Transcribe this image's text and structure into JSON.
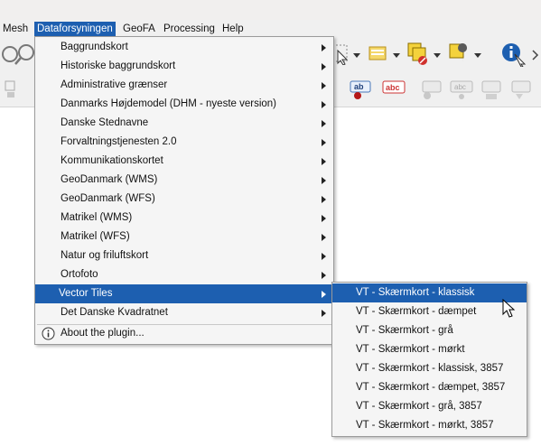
{
  "menubar": {
    "items": [
      {
        "label": "Mesh"
      },
      {
        "label": "Dataforsyningen"
      },
      {
        "label": "GeoFA"
      },
      {
        "label": "Processing"
      },
      {
        "label": "Help"
      }
    ]
  },
  "main_menu": {
    "items": [
      {
        "label": "Baggrundskort"
      },
      {
        "label": "Historiske baggrundskort"
      },
      {
        "label": "Administrative grænser"
      },
      {
        "label": "Danmarks Højdemodel (DHM - nyeste version)"
      },
      {
        "label": "Danske Stednavne"
      },
      {
        "label": "Forvaltningstjenesten 2.0"
      },
      {
        "label": "Kommunikationskortet"
      },
      {
        "label": "GeoDanmark (WMS)"
      },
      {
        "label": "GeoDanmark (WFS)"
      },
      {
        "label": "Matrikel (WMS)"
      },
      {
        "label": "Matrikel (WFS)"
      },
      {
        "label": "Natur og friluftskort"
      },
      {
        "label": "Ortofoto"
      },
      {
        "label": "Vector Tiles"
      },
      {
        "label": "Det Danske Kvadratnet"
      }
    ],
    "about": "About the plugin..."
  },
  "submenu": {
    "items": [
      {
        "label": "VT - Skærmkort - klassisk"
      },
      {
        "label": "VT - Skærmkort - dæmpet"
      },
      {
        "label": "VT - Skærmkort - grå"
      },
      {
        "label": "VT - Skærmkort - mørkt"
      },
      {
        "label": "VT - Skærmkort - klassisk, 3857"
      },
      {
        "label": "VT - Skærmkort - dæmpet, 3857"
      },
      {
        "label": "VT - Skærmkort - grå, 3857"
      },
      {
        "label": "VT - Skærmkort - mørkt, 3857"
      }
    ]
  },
  "toolbar": {
    "label_icon_text_1": "ab",
    "label_icon_text_2": "abc",
    "label_icon_text_3": "abc"
  },
  "colors": {
    "highlight": "#1d5fb0",
    "menu_bg": "#f5f5f5",
    "toolbar_bg": "#f0f0f0"
  },
  "icons": [
    "search-icon",
    "select-features-icon",
    "identify-icon",
    "label-icon",
    "pin-label-icon",
    "cursor-icon"
  ]
}
